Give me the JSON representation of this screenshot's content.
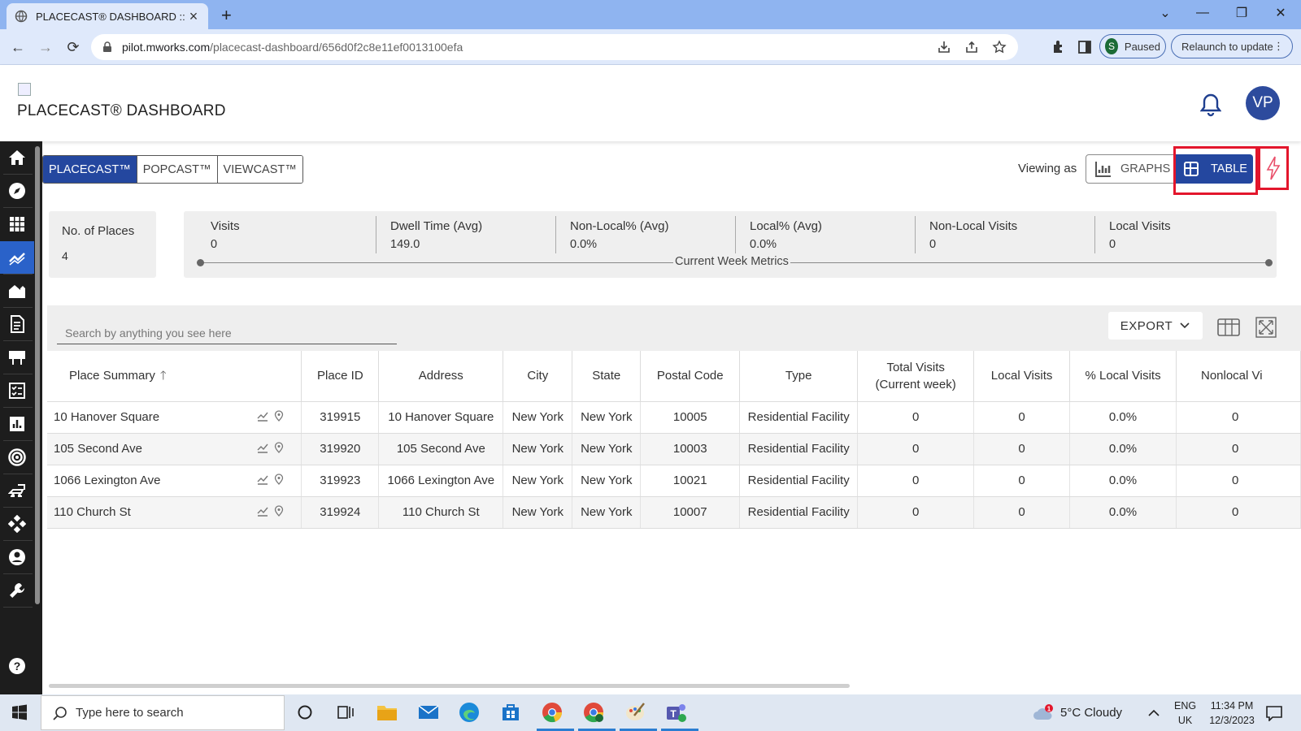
{
  "browser": {
    "tab_title": "PLACECAST® DASHBOARD :: M",
    "url_host": "pilot.mworks.com",
    "url_path": "/placecast-dashboard/656d0f2c8e11ef0013100efa",
    "profile_initial": "S",
    "paused_label": "Paused",
    "relaunch_label": "Relaunch to update"
  },
  "header": {
    "title": "PLACECAST® DASHBOARD",
    "avatar_initials": "VP"
  },
  "sidebar": {
    "items": [
      "home-icon",
      "compass-icon",
      "apps-grid-icon",
      "analytics-icon",
      "buildings-icon",
      "report-icon",
      "billboard-icon",
      "checklist-icon",
      "bar-chart-icon",
      "target-icon",
      "traffic-icon",
      "network-icon",
      "user-icon",
      "wrench-icon"
    ],
    "active_index": 3,
    "help_icon": "help-icon"
  },
  "cast_tabs": [
    {
      "label": "PLACECAST™",
      "active": true
    },
    {
      "label": "POPCAST™",
      "active": false
    },
    {
      "label": "VIEWCAST™",
      "active": false
    }
  ],
  "view_toggle": {
    "viewing_as_label": "Viewing as",
    "graphs_label": "GRAPHS",
    "table_label": "TABLE",
    "selected": "TABLE"
  },
  "places_summary": {
    "label": "No. of Places",
    "value": "4"
  },
  "metrics": {
    "caption": "Current Week Metrics",
    "items": [
      {
        "label": "Visits",
        "value": "0"
      },
      {
        "label": "Dwell Time (Avg)",
        "value": "149.0"
      },
      {
        "label": "Non-Local% (Avg)",
        "value": "0.0%"
      },
      {
        "label": "Local% (Avg)",
        "value": "0.0%"
      },
      {
        "label": "Non-Local Visits",
        "value": "0"
      },
      {
        "label": "Local Visits",
        "value": "0"
      }
    ]
  },
  "table": {
    "search_placeholder": "Search by anything you see here",
    "export_label": "EXPORT",
    "columns": [
      "Place Summary",
      "Place ID",
      "Address",
      "City",
      "State",
      "Postal Code",
      "Type",
      "Total Visits (Current week)",
      "Local Visits",
      "% Local Visits",
      "Nonlocal Vi"
    ],
    "rows": [
      [
        "10 Hanover Square",
        "319915",
        "10 Hanover Square",
        "New York",
        "New York",
        "10005",
        "Residential Facility",
        "0",
        "0",
        "0.0%",
        "0"
      ],
      [
        "105 Second Ave",
        "319920",
        "105 Second Ave",
        "New York",
        "New York",
        "10003",
        "Residential Facility",
        "0",
        "0",
        "0.0%",
        "0"
      ],
      [
        "1066 Lexington Ave",
        "319923",
        "1066 Lexington Ave",
        "New York",
        "New York",
        "10021",
        "Residential Facility",
        "0",
        "0",
        "0.0%",
        "0"
      ],
      [
        "110 Church St",
        "319924",
        "110 Church St",
        "New York",
        "New York",
        "10007",
        "Residential Facility",
        "0",
        "0",
        "0.0%",
        "0"
      ]
    ]
  },
  "taskbar": {
    "search_placeholder": "Type here to search",
    "weather": "5°C  Cloudy",
    "weather_badge": "1",
    "lang_top": "ENG",
    "lang_bottom": "UK",
    "time": "11:34 PM",
    "date": "12/3/2023"
  },
  "colors": {
    "accent": "#24479f",
    "highlight": "#e3162c",
    "sidebar_bg": "#1d1d1d",
    "sidebar_active": "#2a62c9"
  }
}
